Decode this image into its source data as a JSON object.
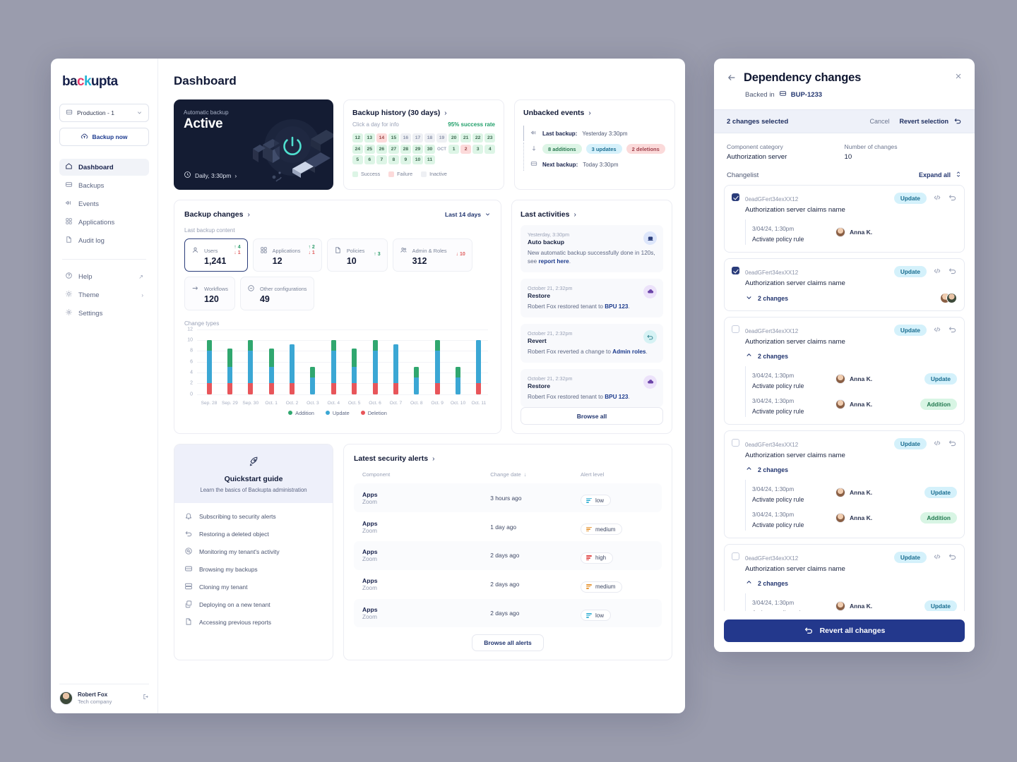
{
  "app": {
    "logo": {
      "p1": "ba",
      "p2": "c",
      "p3": "k",
      "p4": "upta"
    },
    "env_selector": "Production - 1",
    "backup_now": "Backup now",
    "nav": [
      {
        "label": "Dashboard",
        "icon": "home-icon"
      },
      {
        "label": "Backups",
        "icon": "database-icon"
      },
      {
        "label": "Events",
        "icon": "events-icon"
      },
      {
        "label": "Applications",
        "icon": "grid-icon"
      },
      {
        "label": "Audit log",
        "icon": "file-icon"
      }
    ],
    "nav_secondary": [
      {
        "label": "Help",
        "icon": "help-icon",
        "trail": "↗"
      },
      {
        "label": "Theme",
        "icon": "sun-icon",
        "trail": "›"
      },
      {
        "label": "Settings",
        "icon": "gear-icon",
        "trail": ""
      }
    ],
    "user": {
      "name": "Robert Fox",
      "org": "Tech company"
    },
    "page_title": "Dashboard"
  },
  "hero": {
    "label": "Automatic backup",
    "status": "Active",
    "schedule": "Daily, 3:30pm"
  },
  "backup_history": {
    "title": "Backup history (30 days)",
    "hint": "Click a day for info",
    "success_rate": "95% success rate",
    "days": [
      {
        "d": "12",
        "s": "success"
      },
      {
        "d": "13",
        "s": "success"
      },
      {
        "d": "14",
        "s": "failure"
      },
      {
        "d": "15",
        "s": "success"
      },
      {
        "d": "16",
        "s": "inactive"
      },
      {
        "d": "17",
        "s": "inactive"
      },
      {
        "d": "18",
        "s": "inactive"
      },
      {
        "d": "19",
        "s": "inactive"
      },
      {
        "d": "20",
        "s": "success"
      },
      {
        "d": "21",
        "s": "success"
      },
      {
        "d": "22",
        "s": "success"
      },
      {
        "d": "23",
        "s": "success"
      },
      {
        "d": "24",
        "s": "success"
      },
      {
        "d": "25",
        "s": "success"
      },
      {
        "d": "26",
        "s": "success"
      },
      {
        "d": "27",
        "s": "success"
      },
      {
        "d": "28",
        "s": "success"
      },
      {
        "d": "29",
        "s": "success"
      },
      {
        "d": "30",
        "s": "success"
      },
      {
        "d": "OCT",
        "s": "label"
      },
      {
        "d": "1",
        "s": "success"
      },
      {
        "d": "2",
        "s": "failure"
      },
      {
        "d": "3",
        "s": "success"
      },
      {
        "d": "4",
        "s": "success"
      },
      {
        "d": "5",
        "s": "success"
      },
      {
        "d": "6",
        "s": "success"
      },
      {
        "d": "7",
        "s": "success"
      },
      {
        "d": "8",
        "s": "success"
      },
      {
        "d": "9",
        "s": "success"
      },
      {
        "d": "10",
        "s": "success"
      },
      {
        "d": "11",
        "s": "success"
      },
      {
        "d": "",
        "s": "empty"
      }
    ],
    "legend": [
      {
        "label": "Success",
        "color": "#ddf5e6"
      },
      {
        "label": "Failure",
        "color": "#fcdada"
      },
      {
        "label": "Inactive",
        "color": "#eef0f4"
      }
    ]
  },
  "unbacked": {
    "title": "Unbacked events",
    "last_backup_label": "Last backup:",
    "last_backup_value": "Yesterday 3:30pm",
    "pills": [
      {
        "label": "8 additions",
        "kind": "add"
      },
      {
        "label": "3 updates",
        "kind": "upd"
      },
      {
        "label": "2 deletions",
        "kind": "del"
      }
    ],
    "next_backup_label": "Next backup:",
    "next_backup_value": "Today 3:30pm"
  },
  "backup_changes": {
    "title": "Backup changes",
    "period": "Last 14 days",
    "section_label": "Last backup content",
    "tiles": [
      {
        "name": "Users",
        "value": "1,241",
        "up": "↑ 4",
        "down": "↓ 1",
        "icon": "user-icon",
        "selected": true
      },
      {
        "name": "Applications",
        "value": "12",
        "up": "↑ 2",
        "down": "↓ 1",
        "icon": "grid-icon",
        "selected": false
      },
      {
        "name": "Policies",
        "value": "10",
        "up": "↑ 3",
        "down": "",
        "icon": "file-icon",
        "selected": false
      },
      {
        "name": "Admin & Roles",
        "value": "312",
        "up": "",
        "down": "↓ 10",
        "icon": "users-icon",
        "selected": false
      },
      {
        "name": "Workflows",
        "value": "120",
        "up": "",
        "down": "",
        "icon": "arrow-icon",
        "selected": false
      },
      {
        "name": "Other configurations",
        "value": "49",
        "up": "",
        "down": "",
        "icon": "minus-circle-icon",
        "selected": false
      }
    ],
    "chart_label": "Change types"
  },
  "chart_data": {
    "type": "bar",
    "stacked": true,
    "title": "Change types",
    "xlabel": "",
    "ylabel": "",
    "ylim": [
      0,
      12
    ],
    "yticks": [
      0,
      2,
      4,
      6,
      8,
      10,
      12
    ],
    "grid": true,
    "legend_position": "bottom",
    "categories": [
      "Sep. 28",
      "Sep. 29",
      "Sep. 30",
      "Oct. 1",
      "Oct. 2",
      "Oct. 3",
      "Oct. 4",
      "Oct. 5",
      "Oct. 6",
      "Oct. 7",
      "Oct. 8",
      "Oct. 9",
      "Oct. 10",
      "Oct. 11"
    ],
    "series": [
      {
        "name": "Deletion",
        "color": "#e8555a",
        "values": [
          2,
          2,
          2,
          2,
          2,
          0,
          2,
          2,
          2,
          2,
          0,
          2,
          0,
          2
        ]
      },
      {
        "name": "Update",
        "color": "#3ba7d4",
        "values": [
          6,
          3,
          6,
          3,
          7.2,
          3.1,
          6,
          3,
          6,
          7.2,
          3.1,
          6,
          3.1,
          8
        ]
      },
      {
        "name": "Addition",
        "color": "#30a76f",
        "values": [
          2,
          3.5,
          2,
          3.5,
          0,
          2,
          2,
          3.5,
          2,
          0,
          2,
          2,
          2,
          0
        ]
      }
    ],
    "totals": [
      10,
      8.5,
      10,
      8.5,
      9.2,
      5.1,
      10,
      8.5,
      10,
      9.2,
      5.1,
      10,
      5.1,
      10
    ]
  },
  "last_activities": {
    "title": "Last activities",
    "browse_all": "Browse all",
    "items": [
      {
        "time": "Yesterday, 3:30pm",
        "title": "Auto backup",
        "desc_pre": "New automatic backup successfully done in 120s, see ",
        "desc_link": "report here",
        "desc_post": ".",
        "icon": "backup-icon",
        "icon_style": "ic-blue"
      },
      {
        "time": "October 21, 2:32pm",
        "title": "Restore",
        "desc_pre": "Robert Fox restored tenant to ",
        "desc_link": "BPU 123",
        "desc_post": ".",
        "icon": "cloud-restore-icon",
        "icon_style": "ic-purple"
      },
      {
        "time": "October 21, 2:32pm",
        "title": "Revert",
        "desc_pre": "Robert Fox reverted a change to ",
        "desc_link": "Admin roles",
        "desc_post": ".",
        "icon": "revert-icon",
        "icon_style": "ic-cyan"
      },
      {
        "time": "October 21, 2:32pm",
        "title": "Restore",
        "desc_pre": "Robert Fox restored tenant to ",
        "desc_link": "BPU 123",
        "desc_post": ".",
        "icon": "cloud-restore-icon",
        "icon_style": "ic-purple"
      }
    ]
  },
  "quickstart": {
    "title": "Quickstart guide",
    "subtitle": "Learn the basics of Backupta administration",
    "items": [
      {
        "label": "Subscribing to security alerts",
        "icon": "bell-icon"
      },
      {
        "label": "Restoring a deleted object",
        "icon": "revert-icon"
      },
      {
        "label": "Monitoring my tenant's activity",
        "icon": "search-icon"
      },
      {
        "label": "Browsing my backups",
        "icon": "database-icon"
      },
      {
        "label": "Cloning my tenant",
        "icon": "clone-icon"
      },
      {
        "label": "Deploying on a new tenant",
        "icon": "copy-icon"
      },
      {
        "label": "Accessing previous reports",
        "icon": "file-icon"
      }
    ]
  },
  "security_alerts": {
    "title": "Latest security alerts",
    "columns": [
      "Component",
      "Change date",
      "Alert level"
    ],
    "sort_icon": "↓",
    "browse_all": "Browse all alerts",
    "rows": [
      {
        "component": "Apps",
        "sub": "Zoom",
        "date": "3 hours ago",
        "level": "low"
      },
      {
        "component": "Apps",
        "sub": "Zoom",
        "date": "1 day ago",
        "level": "medium"
      },
      {
        "component": "Apps",
        "sub": "Zoom",
        "date": "2 days ago",
        "level": "high"
      },
      {
        "component": "Apps",
        "sub": "Zoom",
        "date": "2 days ago",
        "level": "medium"
      },
      {
        "component": "Apps",
        "sub": "Zoom",
        "date": "2 days ago",
        "level": "low"
      }
    ]
  },
  "panel": {
    "title": "Dependency changes",
    "backed_in_label": "Backed in",
    "backed_in_value": "BUP-1233",
    "selection_count": "2 changes selected",
    "cancel": "Cancel",
    "revert_selection": "Revert selection",
    "meta": {
      "category_key": "Component category",
      "category_value": "Authorization server",
      "count_key": "Number of changes",
      "count_value": "10"
    },
    "changelist_label": "Changelist",
    "expand_all": "Expand all",
    "revert_all": "Revert all changes",
    "items": [
      {
        "id": "0eadGFert34exXX12",
        "name": "Authorization server claims name",
        "tag": "Update",
        "checked": true,
        "mode": "inline",
        "detail": {
          "ts": "3/04/24, 1:30pm",
          "action": "Activate policy rule",
          "user": "Anna K."
        }
      },
      {
        "id": "0eadGFert34exXX12",
        "name": "Authorization server claims name",
        "tag": "Update",
        "checked": true,
        "mode": "collapsed",
        "toggle_label": "2 changes"
      },
      {
        "id": "0eadGFert34exXX12",
        "name": "Authorization server claims name",
        "tag": "Update",
        "checked": false,
        "mode": "expanded",
        "toggle_label": "2 changes",
        "changes": [
          {
            "ts": "3/04/24, 1:30pm",
            "action": "Activate policy rule",
            "user": "Anna K.",
            "tag": "Update"
          },
          {
            "ts": "3/04/24, 1:30pm",
            "action": "Activate policy rule",
            "user": "Anna K.",
            "tag": "Addition"
          }
        ]
      },
      {
        "id": "0eadGFert34exXX12",
        "name": "Authorization server claims name",
        "tag": "Update",
        "checked": false,
        "mode": "expanded",
        "toggle_label": "2 changes",
        "changes": [
          {
            "ts": "3/04/24, 1:30pm",
            "action": "Activate policy rule",
            "user": "Anna K.",
            "tag": "Update"
          },
          {
            "ts": "3/04/24, 1:30pm",
            "action": "Activate policy rule",
            "user": "Anna K.",
            "tag": "Addition"
          }
        ]
      },
      {
        "id": "0eadGFert34exXX12",
        "name": "Authorization server claims name",
        "tag": "Update",
        "checked": false,
        "mode": "expanded",
        "toggle_label": "2 changes",
        "changes": [
          {
            "ts": "3/04/24, 1:30pm",
            "action": "Activate policy rule",
            "user": "Anna K.",
            "tag": "Update"
          }
        ]
      }
    ]
  }
}
